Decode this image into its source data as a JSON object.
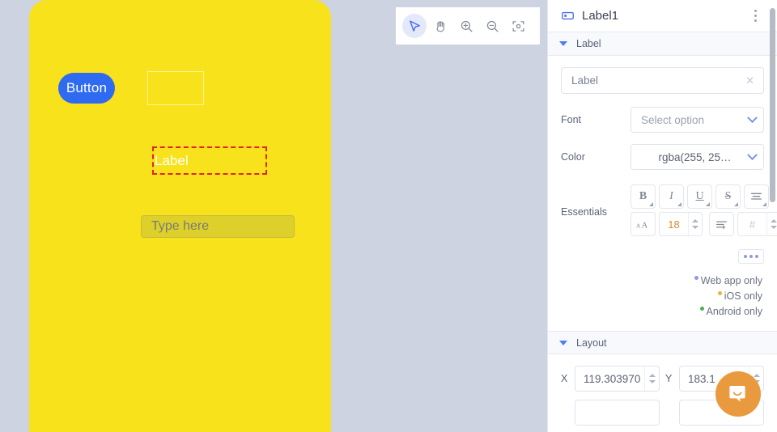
{
  "canvas": {
    "toolbar": {
      "tools": [
        {
          "name": "select-tool",
          "icon": "cursor-icon",
          "active": true
        },
        {
          "name": "pan-tool",
          "icon": "hand-icon",
          "active": false
        },
        {
          "name": "zoom-in-tool",
          "icon": "zoom-in-icon",
          "active": false
        },
        {
          "name": "zoom-out-tool",
          "icon": "zoom-out-icon",
          "active": false
        },
        {
          "name": "fit-screen-tool",
          "icon": "fit-screen-icon",
          "active": false
        }
      ]
    },
    "device_background": "#f8e21c",
    "widgets": {
      "button_label": "Button",
      "button_color": "#2f6bf0",
      "label_text": "Label",
      "label_selection_color": "#e02424",
      "input_placeholder": "Type here"
    }
  },
  "panel": {
    "header": {
      "icon": "label-tag-icon",
      "title": "Label1",
      "menu_icon": "kebab-menu-icon"
    },
    "label_section": {
      "title": "Label",
      "text_field": {
        "value": "Label",
        "clear_icon": "clear-x-icon"
      },
      "font": {
        "label": "Font",
        "placeholder": "Select option",
        "value": "Select option"
      },
      "color": {
        "label": "Color",
        "value": "rgba(255, 25…"
      },
      "essentials": {
        "label": "Essentials",
        "buttons_row1": [
          {
            "name": "bold-button",
            "glyph": "B"
          },
          {
            "name": "italic-button",
            "glyph": "I"
          },
          {
            "name": "underline-button",
            "glyph": "U"
          },
          {
            "name": "strikethrough-button",
            "glyph": "S"
          },
          {
            "name": "align-button",
            "glyph": "align-icon"
          }
        ],
        "font_size_icon": "font-size-icon",
        "font_size_value": "18",
        "line_spacing_icon": "line-spacing-icon",
        "line_height_placeholder": "#"
      },
      "more_button": "more-options-button"
    },
    "platform_legend": [
      {
        "text": "Web app only",
        "color": "#8f9ae8"
      },
      {
        "text": "iOS only",
        "color": "#f0b13c"
      },
      {
        "text": "Android only",
        "color": "#4caf50"
      }
    ],
    "layout_section": {
      "title": "Layout",
      "x_label": "X",
      "x_value": "119.303970",
      "y_label": "Y",
      "y_value": "183.1"
    }
  },
  "chat": {
    "launcher_icon": "chat-bubble-icon",
    "color": "#ea9a3e"
  }
}
